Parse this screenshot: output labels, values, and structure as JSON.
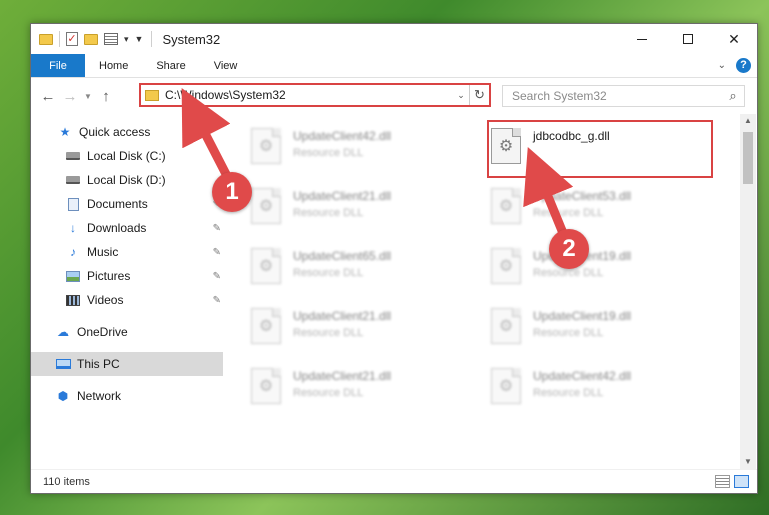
{
  "window": {
    "title": "System32",
    "quick_access_icons": [
      "folder-icon",
      "checkmark-icon",
      "new-folder-icon",
      "properties-icon"
    ]
  },
  "ribbon": {
    "file_label": "File",
    "tabs": [
      "Home",
      "Share",
      "View"
    ]
  },
  "address": {
    "path": "C:\\Windows\\System32"
  },
  "search": {
    "placeholder": "Search System32"
  },
  "sidebar": {
    "items": [
      {
        "label": "Quick access",
        "icon": "star-icon"
      },
      {
        "label": "Local Disk (C:)",
        "icon": "drive-icon"
      },
      {
        "label": "Local Disk (D:)",
        "icon": "drive-icon"
      },
      {
        "label": "Documents",
        "icon": "documents-icon",
        "pinned": true
      },
      {
        "label": "Downloads",
        "icon": "downloads-icon",
        "pinned": true
      },
      {
        "label": "Music",
        "icon": "music-icon",
        "pinned": true
      },
      {
        "label": "Pictures",
        "icon": "pictures-icon",
        "pinned": true
      },
      {
        "label": "Videos",
        "icon": "videos-icon",
        "pinned": true
      },
      {
        "label": "OneDrive",
        "icon": "cloud-icon"
      },
      {
        "label": "This PC",
        "icon": "computer-icon",
        "selected": true
      },
      {
        "label": "Network",
        "icon": "network-icon"
      }
    ]
  },
  "files": [
    {
      "name": "UpdateClient42.dll",
      "type": "Resource DLL",
      "blurred": true
    },
    {
      "name": "jdbcodbc_g.dll",
      "type": "",
      "blurred": false,
      "highlighted": true
    },
    {
      "name": "UpdateClient21.dll",
      "type": "Resource DLL",
      "blurred": true
    },
    {
      "name": "UpdateClient53.dll",
      "type": "Resource DLL",
      "blurred": true
    },
    {
      "name": "UpdateClient65.dll",
      "type": "Resource DLL",
      "blurred": true
    },
    {
      "name": "UpdateClient19.dll",
      "type": "Resource DLL",
      "blurred": true
    },
    {
      "name": "UpdateClient21.dll",
      "type": "Resource DLL",
      "blurred": true
    },
    {
      "name": "UpdateClient19.dll",
      "type": "Resource DLL",
      "blurred": true
    },
    {
      "name": "UpdateClient21.dll",
      "type": "Resource DLL",
      "blurred": true
    },
    {
      "name": "UpdateClient42.dll",
      "type": "Resource DLL",
      "blurred": true
    }
  ],
  "status": {
    "item_count": "110 items"
  },
  "annotations": {
    "callout_1": "1",
    "callout_2": "2",
    "highlight_color": "#d94343"
  }
}
